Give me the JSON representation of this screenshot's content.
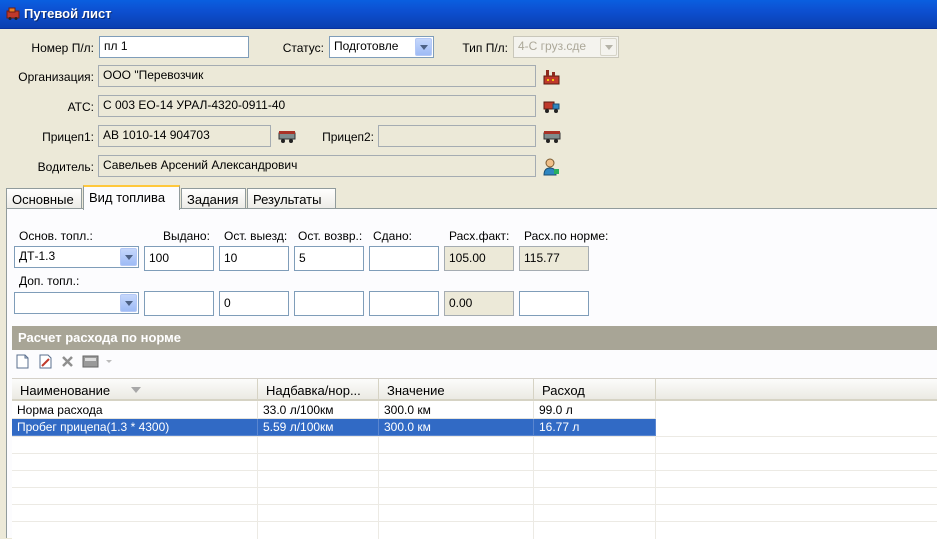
{
  "window": {
    "title": "Путевой лист"
  },
  "header": {
    "number_label": "Номер П/л:",
    "number_value": "пл 1",
    "status_label": "Статус:",
    "status_value": "Подготовле",
    "type_label": "Тип П/л:",
    "type_value": "4-С груз.сде",
    "org_label": "Организация:",
    "org_value": "ООО \"Перевозчик",
    "ats_label": "АТС:",
    "ats_value": "С 003 ЕО-14 УРАЛ-4320-0911-40",
    "trailer1_label": "Прицеп1:",
    "trailer1_value": "АВ 1010-14 904703",
    "trailer2_label": "Прицеп2:",
    "trailer2_value": "",
    "driver_label": "Водитель:",
    "driver_value": "Савельев Арсений Александрович"
  },
  "tabs": [
    {
      "label": "Основные",
      "active": false
    },
    {
      "label": "Вид топлива",
      "active": true
    },
    {
      "label": "Задания",
      "active": false
    },
    {
      "label": "Результаты",
      "active": false
    }
  ],
  "fuel": {
    "col_labels": [
      "Основ. топл.:",
      "Выдано:",
      "Ост. выезд:",
      "Ост. возвр.:",
      "Сдано:",
      "Расх.факт:",
      "Расх.по норме:"
    ],
    "main": {
      "type": "ДТ-1.3",
      "issued": "100",
      "rest_out": "10",
      "rest_in": "5",
      "handed": "",
      "fact": "105.00",
      "norm": "115.77"
    },
    "extra_label": "Доп. топл.:",
    "extra": {
      "type": "",
      "issued": "",
      "rest_out": "0",
      "rest_in": "",
      "handed": "",
      "fact": "0.00",
      "norm": ""
    }
  },
  "calc": {
    "title": "Расчет расхода по норме",
    "toolbar": [
      "new-doc-icon",
      "edit-doc-icon",
      "delete-icon",
      "calculator-icon"
    ],
    "columns": [
      "Наименование",
      "Надбавка/нор...",
      "Значение",
      "Расход"
    ],
    "rows": [
      {
        "name": "Норма расхода",
        "rate": "33.0 л/100км",
        "value": "300.0 км",
        "consumption": "99.0 л",
        "selected": false
      },
      {
        "name": "Пробег прицепа(1.3 * 4300)",
        "rate": "5.59 л/100км",
        "value": "300.0 км",
        "consumption": "16.77 л",
        "selected": true
      }
    ]
  },
  "colors": {
    "title_bar": "#0a5fe0",
    "selection": "#316ac5",
    "section_bar": "#a8a596",
    "tab_accent": "#ffc83c"
  }
}
